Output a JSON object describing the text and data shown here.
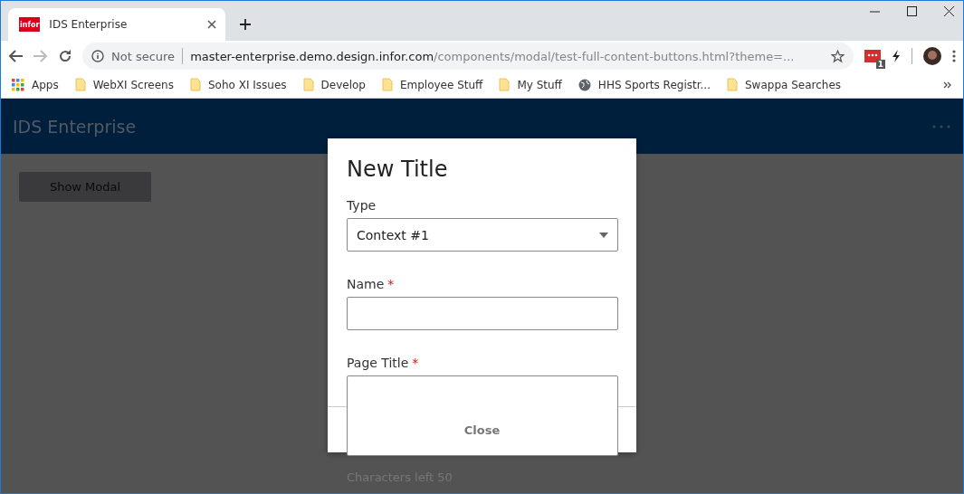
{
  "browser": {
    "tab": {
      "title": "IDS Enterprise",
      "favicon": "infor"
    },
    "address": {
      "security": "Not secure",
      "host": "master-enterprise.demo.design.infor.com",
      "path": "/components/modal/test-full-content-buttons.html?theme=..."
    },
    "extension_badge": "1",
    "bookmarks": [
      {
        "label": "Apps",
        "kind": "apps"
      },
      {
        "label": "WebXI Screens",
        "kind": "folder"
      },
      {
        "label": "Soho XI Issues",
        "kind": "folder"
      },
      {
        "label": "Develop",
        "kind": "folder"
      },
      {
        "label": "Employee Stuff",
        "kind": "folder"
      },
      {
        "label": "My Stuff",
        "kind": "folder"
      },
      {
        "label": "HHS Sports Registr...",
        "kind": "site"
      },
      {
        "label": "Swappa Searches",
        "kind": "folder"
      }
    ]
  },
  "app": {
    "title": "IDS Enterprise",
    "button": "Show Modal"
  },
  "modal": {
    "title": "New Title",
    "fields": [
      {
        "label": "Type",
        "kind": "select",
        "value": "Context #1",
        "required": false
      },
      {
        "label": "Name",
        "kind": "input",
        "required": true
      },
      {
        "label": "Page Title",
        "kind": "textarea",
        "required": true
      }
    ],
    "required_mark": "*",
    "counter": "Characters left 50",
    "close": "Close"
  }
}
